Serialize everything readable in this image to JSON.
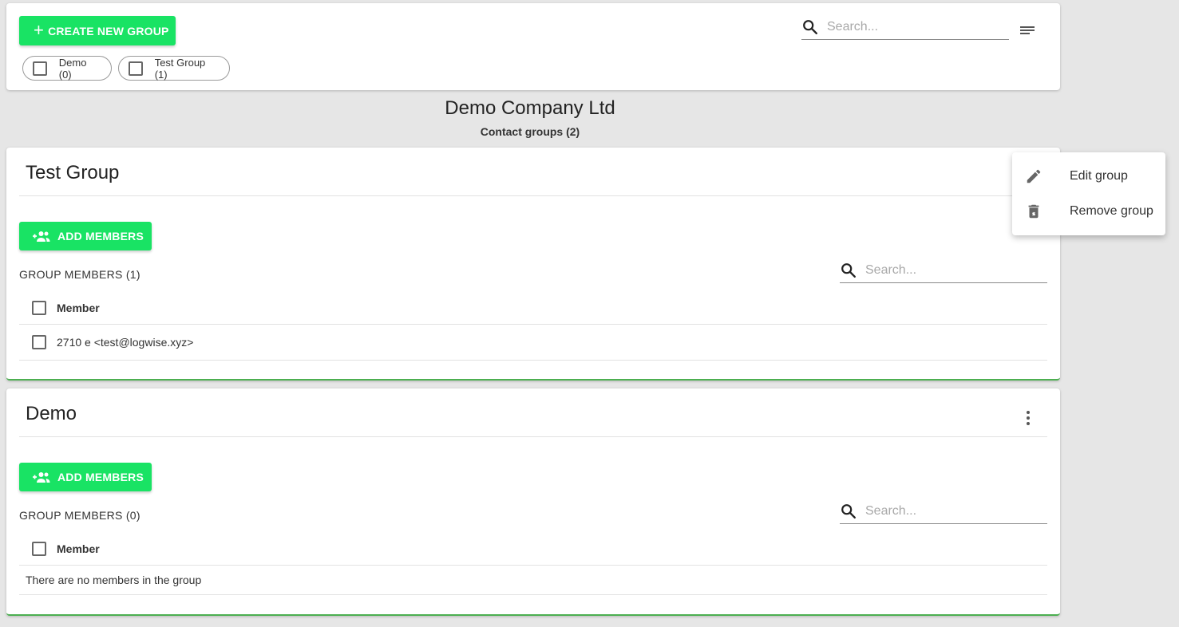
{
  "toolbar": {
    "create_label": "CREATE NEW GROUP",
    "search_placeholder": "Search...",
    "filter_icon": "sort-lines-icon",
    "chips": [
      {
        "label": "Demo (0)"
      },
      {
        "label": "Test Group (1)"
      }
    ]
  },
  "heading": {
    "company": "Demo Company Ltd",
    "groups_count": "Contact groups (2)"
  },
  "groups": [
    {
      "title": "Test Group",
      "add_label": "ADD MEMBERS",
      "members_label": "GROUP MEMBERS (1)",
      "search_placeholder": "Search...",
      "column_header": "Member",
      "rows": [
        "2710 e <test@logwise.xyz>"
      ]
    },
    {
      "title": "Demo",
      "add_label": "ADD MEMBERS",
      "members_label": "GROUP MEMBERS (0)",
      "search_placeholder": "Search...",
      "column_header": "Member",
      "empty_text": "There are no members in the group"
    }
  ],
  "context_menu": {
    "items": [
      {
        "label": "Edit group",
        "icon": "pencil-icon"
      },
      {
        "label": "Remove group",
        "icon": "trash-icon"
      }
    ]
  },
  "colors": {
    "accent": "#19e364",
    "card_border_bottom": "#4caf50",
    "background": "#e6e6e6"
  }
}
